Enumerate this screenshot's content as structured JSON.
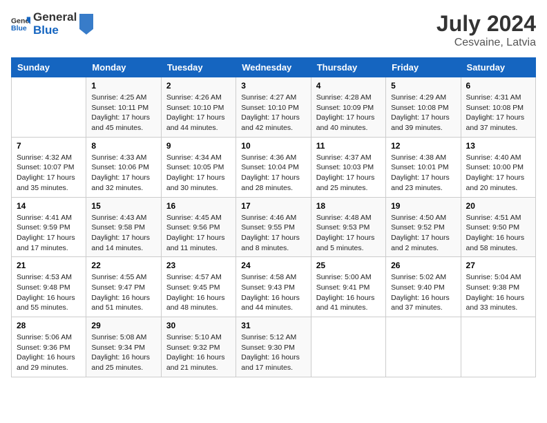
{
  "header": {
    "logo_line1": "General",
    "logo_line2": "Blue",
    "month_year": "July 2024",
    "location": "Cesvaine, Latvia"
  },
  "weekdays": [
    "Sunday",
    "Monday",
    "Tuesday",
    "Wednesday",
    "Thursday",
    "Friday",
    "Saturday"
  ],
  "weeks": [
    [
      {
        "day": "",
        "info": ""
      },
      {
        "day": "1",
        "info": "Sunrise: 4:25 AM\nSunset: 10:11 PM\nDaylight: 17 hours\nand 45 minutes."
      },
      {
        "day": "2",
        "info": "Sunrise: 4:26 AM\nSunset: 10:10 PM\nDaylight: 17 hours\nand 44 minutes."
      },
      {
        "day": "3",
        "info": "Sunrise: 4:27 AM\nSunset: 10:10 PM\nDaylight: 17 hours\nand 42 minutes."
      },
      {
        "day": "4",
        "info": "Sunrise: 4:28 AM\nSunset: 10:09 PM\nDaylight: 17 hours\nand 40 minutes."
      },
      {
        "day": "5",
        "info": "Sunrise: 4:29 AM\nSunset: 10:08 PM\nDaylight: 17 hours\nand 39 minutes."
      },
      {
        "day": "6",
        "info": "Sunrise: 4:31 AM\nSunset: 10:08 PM\nDaylight: 17 hours\nand 37 minutes."
      }
    ],
    [
      {
        "day": "7",
        "info": "Sunrise: 4:32 AM\nSunset: 10:07 PM\nDaylight: 17 hours\nand 35 minutes."
      },
      {
        "day": "8",
        "info": "Sunrise: 4:33 AM\nSunset: 10:06 PM\nDaylight: 17 hours\nand 32 minutes."
      },
      {
        "day": "9",
        "info": "Sunrise: 4:34 AM\nSunset: 10:05 PM\nDaylight: 17 hours\nand 30 minutes."
      },
      {
        "day": "10",
        "info": "Sunrise: 4:36 AM\nSunset: 10:04 PM\nDaylight: 17 hours\nand 28 minutes."
      },
      {
        "day": "11",
        "info": "Sunrise: 4:37 AM\nSunset: 10:03 PM\nDaylight: 17 hours\nand 25 minutes."
      },
      {
        "day": "12",
        "info": "Sunrise: 4:38 AM\nSunset: 10:01 PM\nDaylight: 17 hours\nand 23 minutes."
      },
      {
        "day": "13",
        "info": "Sunrise: 4:40 AM\nSunset: 10:00 PM\nDaylight: 17 hours\nand 20 minutes."
      }
    ],
    [
      {
        "day": "14",
        "info": "Sunrise: 4:41 AM\nSunset: 9:59 PM\nDaylight: 17 hours\nand 17 minutes."
      },
      {
        "day": "15",
        "info": "Sunrise: 4:43 AM\nSunset: 9:58 PM\nDaylight: 17 hours\nand 14 minutes."
      },
      {
        "day": "16",
        "info": "Sunrise: 4:45 AM\nSunset: 9:56 PM\nDaylight: 17 hours\nand 11 minutes."
      },
      {
        "day": "17",
        "info": "Sunrise: 4:46 AM\nSunset: 9:55 PM\nDaylight: 17 hours\nand 8 minutes."
      },
      {
        "day": "18",
        "info": "Sunrise: 4:48 AM\nSunset: 9:53 PM\nDaylight: 17 hours\nand 5 minutes."
      },
      {
        "day": "19",
        "info": "Sunrise: 4:50 AM\nSunset: 9:52 PM\nDaylight: 17 hours\nand 2 minutes."
      },
      {
        "day": "20",
        "info": "Sunrise: 4:51 AM\nSunset: 9:50 PM\nDaylight: 16 hours\nand 58 minutes."
      }
    ],
    [
      {
        "day": "21",
        "info": "Sunrise: 4:53 AM\nSunset: 9:48 PM\nDaylight: 16 hours\nand 55 minutes."
      },
      {
        "day": "22",
        "info": "Sunrise: 4:55 AM\nSunset: 9:47 PM\nDaylight: 16 hours\nand 51 minutes."
      },
      {
        "day": "23",
        "info": "Sunrise: 4:57 AM\nSunset: 9:45 PM\nDaylight: 16 hours\nand 48 minutes."
      },
      {
        "day": "24",
        "info": "Sunrise: 4:58 AM\nSunset: 9:43 PM\nDaylight: 16 hours\nand 44 minutes."
      },
      {
        "day": "25",
        "info": "Sunrise: 5:00 AM\nSunset: 9:41 PM\nDaylight: 16 hours\nand 41 minutes."
      },
      {
        "day": "26",
        "info": "Sunrise: 5:02 AM\nSunset: 9:40 PM\nDaylight: 16 hours\nand 37 minutes."
      },
      {
        "day": "27",
        "info": "Sunrise: 5:04 AM\nSunset: 9:38 PM\nDaylight: 16 hours\nand 33 minutes."
      }
    ],
    [
      {
        "day": "28",
        "info": "Sunrise: 5:06 AM\nSunset: 9:36 PM\nDaylight: 16 hours\nand 29 minutes."
      },
      {
        "day": "29",
        "info": "Sunrise: 5:08 AM\nSunset: 9:34 PM\nDaylight: 16 hours\nand 25 minutes."
      },
      {
        "day": "30",
        "info": "Sunrise: 5:10 AM\nSunset: 9:32 PM\nDaylight: 16 hours\nand 21 minutes."
      },
      {
        "day": "31",
        "info": "Sunrise: 5:12 AM\nSunset: 9:30 PM\nDaylight: 16 hours\nand 17 minutes."
      },
      {
        "day": "",
        "info": ""
      },
      {
        "day": "",
        "info": ""
      },
      {
        "day": "",
        "info": ""
      }
    ]
  ]
}
